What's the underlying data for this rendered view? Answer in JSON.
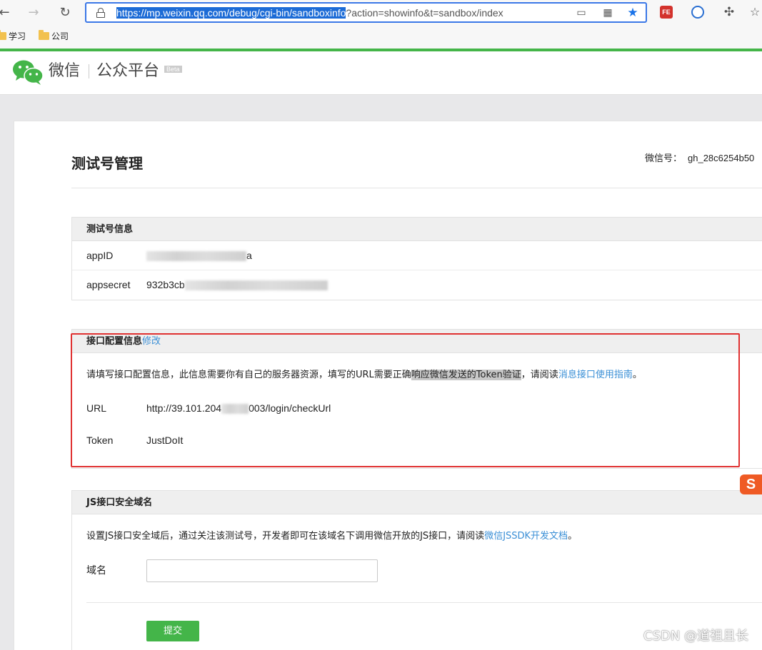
{
  "browser": {
    "url_selected": "https://mp.weixin.qq.com/debug/cgi-bin/sandboxinfo",
    "url_rest": "?action=showinfo&t=sandbox/index",
    "bookmarks": [
      "学习",
      "公司"
    ],
    "extensions": [
      "FE"
    ]
  },
  "header": {
    "brand": "微信",
    "subtitle": "公众平台",
    "beta": "Beta"
  },
  "page": {
    "title": "测试号管理",
    "wx_id_label": "微信号：",
    "wx_id_value": "gh_28c6254b50"
  },
  "test_account": {
    "heading": "测试号信息",
    "appid_label": "appID",
    "appid_suffix": "a",
    "appsecret_label": "appsecret",
    "appsecret_prefix": "932b3cb"
  },
  "interface_config": {
    "heading": "接口配置信息",
    "edit_link": "修改",
    "note_before": "请填写接口配置信息，此信息需要你有自己的服务器资源，填写的URL需要正确",
    "note_highlight": "响应微信发送的Token验证",
    "note_middle": "，请阅读",
    "note_link": "消息接口使用指南",
    "note_end": "。",
    "url_label": "URL",
    "url_prefix": "http://39.101.204",
    "url_suffix": "003/login/checkUrl",
    "token_label": "Token",
    "token_value": "JustDoIt"
  },
  "js_domain": {
    "heading": "JS接口安全域名",
    "note_before": "设置JS接口安全域后，通过关注该测试号，开发者即可在该域名下调用微信开放的JS接口，请阅读",
    "note_link": "微信JSSDK开发文档",
    "note_end": "。",
    "domain_label": "域名",
    "domain_value": "",
    "submit_label": "提交"
  },
  "overlay": {
    "sogou": "S",
    "watermark": "CSDN @道祖且长"
  },
  "colors": {
    "brand_green": "#44b549",
    "link_blue": "#3a8fd6",
    "highlight_red": "#e03131",
    "address_focus": "#3b78e7"
  }
}
